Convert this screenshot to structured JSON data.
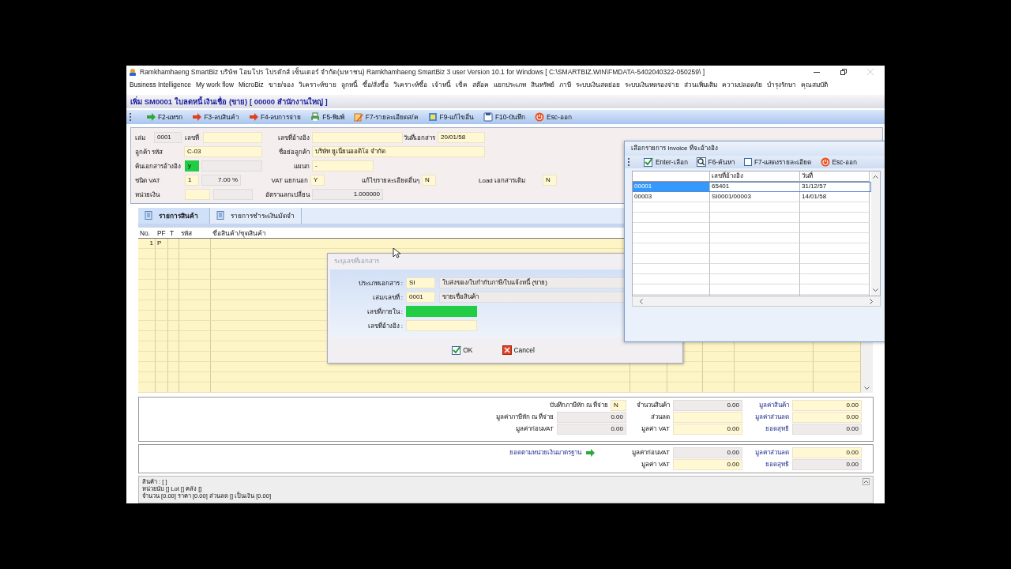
{
  "window": {
    "title": "Ramkhamhaeng SmartBiz บริษัท โอมโปร โปรดักส์ เซ็นเตอร์ จำกัด(มหาชน) Ramkhamhaeng SmartBiz 3 user Version 10.1 for Windows [ C:\\SMARTBIZ.WIN\\FMDATA-5402040322-050259\\ ]"
  },
  "menu": [
    "Business Intelligence",
    "My work flow",
    "MicroBiz",
    "ขาย/จอง",
    "วิเคราะห์ขาย",
    "ลูกหนี้",
    "ซื้อ/สั่งซื้อ",
    "วิเคราะห์ซื้อ",
    "เจ้าหนี้",
    "เช็ค",
    "สต๊อค",
    "แยกประเภท",
    "สินทรัพย์",
    "ภาษี",
    "ระบบเงินสดย่อย",
    "ระบบเงินทดรองจ่าย",
    "ส่วนเพิ่มเติม",
    "ความปลอดภัย",
    "บำรุงรักษา",
    "คุณสมบัติ"
  ],
  "form_title": "เพิ่ม SM0001 ใบลดหนี้ เงินเชื่อ (ขาย) [ 00000 สำนักงานใหญ่ ]",
  "toolbar": [
    "F2-แทรก",
    "F3-ลบสินค้า",
    "F4-ลบการจ่าย",
    "F5-พิมพ์",
    "F7-รายละเอียดส/ค",
    "F9-แก้ไขอื่น",
    "F10-บันทึก",
    "Esc-ออก"
  ],
  "form": [
    [
      {
        "label": "เล่ม",
        "value": "0001",
        "kind": "readonly"
      },
      {
        "label": "เลขที่",
        "kind": "input"
      },
      {
        "label": "เลขที่อ้างอิง",
        "kind": "input"
      },
      {
        "label": "วันที่เอกสาร",
        "value": "20/01/58",
        "kind": "input"
      }
    ],
    [
      {
        "label": "ลูกค้า รหัส",
        "value": "C-03",
        "kind": "input"
      },
      {
        "label": "ชื่อย่อลูกค้า",
        "value": "บริษัท ยูเนี่ยนออดิโอ จำกัด",
        "kind": "input"
      }
    ],
    [
      {
        "label": "ค้นเอกสารอ้างอิง",
        "value": "y",
        "kind": "highlight"
      },
      {
        "kind": "readonly"
      },
      {
        "label": "แผนก",
        "value": "-",
        "kind": "input"
      }
    ],
    [
      {
        "label": "ชนิด VAT",
        "value": "1",
        "kind": "input"
      },
      {
        "value": "7.00 %",
        "kind": "readonly"
      },
      {
        "label": "VAT แยกนอก",
        "value": "Y",
        "kind": "input"
      },
      {
        "label": "แก้ไขรายละเอียดอื่นๆ",
        "value": "N",
        "kind": "input"
      },
      {
        "label": "Load เอกสารเดิม",
        "value": "N",
        "kind": "input"
      }
    ],
    [
      {
        "label": "หน่วยเงิน",
        "kind": "input"
      },
      {
        "kind": "readonly"
      },
      {
        "label": "อัตราแลกเปลี่ยน",
        "value": "1.000000",
        "kind": "readonly"
      }
    ]
  ],
  "tabs": [
    {
      "label": "รายการสินค้า",
      "selected": true
    },
    {
      "label": "รายการชำระเงินมัดจำ",
      "selected": false
    }
  ],
  "grid": {
    "columns": [
      "No.",
      "PF",
      "T",
      "รหัส",
      "ชื่อสินค้า/ชุดสินค้า"
    ],
    "rows": [
      {
        "cells": [
          "1",
          "P"
        ]
      }
    ]
  },
  "totals": [
    [
      {
        "label": "บันทึกภาษีหัก ณ ที่จ่าย",
        "value": "N",
        "kind": "input"
      },
      {
        "label": "จำนวนสินค้า",
        "value": "0.00",
        "kind": "readonly"
      },
      {
        "label": "มูลค่าสินค้า",
        "value": "0.00",
        "kind": "input"
      }
    ],
    [
      {
        "label": "มูลค่าภาษีหัก ณ ที่จ่าย",
        "value": "0.00",
        "kind": "readonly"
      },
      {
        "label": "ส่วนลด",
        "kind": "input"
      },
      {
        "label": "มูลค่าส่วนลด",
        "value": "0.00",
        "kind": "input"
      }
    ],
    [
      {
        "label": "มูลค่าก่อนVAT",
        "value": "0.00",
        "kind": "readonly"
      },
      {
        "label": "มูลค่า VAT",
        "value": "0.00",
        "kind": "input"
      },
      {
        "label": "ยอดสุทธิ",
        "value": "0.00",
        "kind": "readonly"
      }
    ]
  ],
  "standard_totals": {
    "link": "ยอดตามหน่วยเงินมาตรฐาน",
    "rows": [
      [
        {
          "label": "มูลค่าก่อนVAT",
          "value": "0.00",
          "kind": "readonly"
        },
        {
          "label": "มูลค่าส่วนลด",
          "value": "0.00",
          "kind": "input"
        }
      ],
      [
        {
          "label": "มูลค่า VAT",
          "value": "0.00",
          "kind": "input"
        },
        {
          "label": "ยอดสุทธิ",
          "value": "0.00",
          "kind": "readonly"
        }
      ]
    ]
  },
  "status": [
    "สินค้า : [ ]",
    "หน่วยนับ [] Lot [] คลัง []",
    "จำนวน [0.00] ราคา [0.00] ส่วนลด [] เป็นเงิน [0.00]"
  ],
  "dialog": {
    "title": "ระบุเลขที่เอกสาร",
    "rows": [
      {
        "label": "ประเภทเอกสาร :",
        "fields": [
          {
            "value": "SI",
            "kind": "input"
          },
          {
            "value": "ใบส่งของ/ใบกำกับภาษี/ใบแจ้งหนี้ (ขาย)",
            "kind": "readonly"
          }
        ]
      },
      {
        "label": "เล่ม/เลขที่ :",
        "fields": [
          {
            "value": "0001",
            "kind": "input"
          },
          {
            "value": "ขายเชื่อสินค้า",
            "kind": "readonly"
          }
        ]
      },
      {
        "label": "เลขที่ภายใน :",
        "fields": [
          {
            "kind": "highlight"
          }
        ]
      },
      {
        "label": "เลขที่อ้างอิง :",
        "fields": [
          {
            "kind": "input"
          }
        ]
      }
    ],
    "buttons": [
      "OK",
      "Cancel"
    ]
  },
  "picker": {
    "title": "เลือกรายการ Invoice ที่จะอ้างอิง",
    "toolbar": [
      {
        "kind": "button",
        "label": "Enter-เลือก"
      },
      {
        "kind": "button",
        "label": "F6-ค้นหา"
      },
      {
        "kind": "toggle",
        "label": "F7-แสดงรายละเอียด",
        "checked": false
      },
      {
        "kind": "button",
        "label": "Esc-ออก"
      }
    ],
    "columns": [
      "",
      "เลขที่อ้างอิง",
      "วันที่"
    ],
    "rows": [
      {
        "cells": [
          "00001",
          "65401",
          "31/12/57"
        ],
        "selected": true
      },
      {
        "cells": [
          "00003",
          "SI0001/00003",
          "14/01/58"
        ],
        "selected": false
      }
    ]
  }
}
